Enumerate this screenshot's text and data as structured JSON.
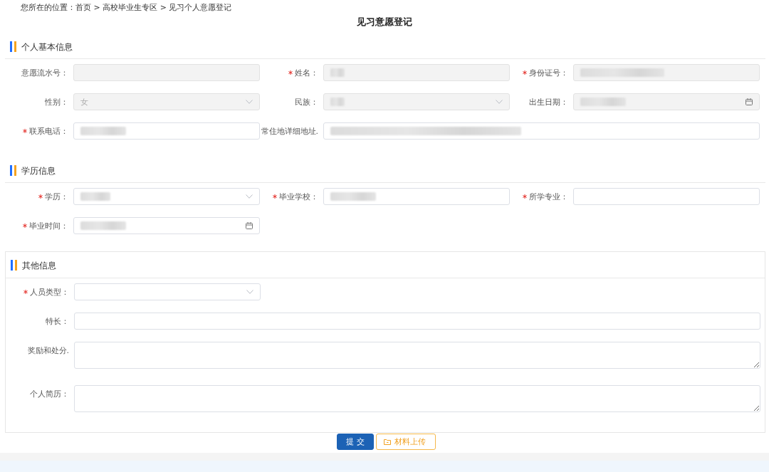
{
  "breadcrumb": "您所在的位置：首页 > 高校毕业生专区 > 见习个人意愿登记",
  "title": "见习意愿登记",
  "sections": [
    {
      "title": "个人基本信息",
      "boxed": false,
      "rows": [
        [
          {
            "label": "意愿流水号：",
            "kind": "text",
            "required": false,
            "disabled": true
          },
          {
            "label": "姓名：",
            "kind": "text",
            "required": true,
            "disabled": true,
            "blurred_value": {
              "kind": "short"
            }
          },
          {
            "label": "身份证号：",
            "kind": "text",
            "required": true,
            "disabled": true,
            "blurred_value": {
              "kind": "long"
            }
          }
        ],
        [
          {
            "label": "性别：",
            "kind": "select",
            "required": false,
            "disabled": true,
            "value": "女"
          },
          {
            "label": "民族：",
            "kind": "select",
            "required": false,
            "disabled": true,
            "blurred_value": {
              "kind": "short"
            }
          },
          {
            "label": "出生日期：",
            "kind": "date",
            "required": false,
            "disabled": true,
            "blurred_value": {
              "kind": "medium"
            }
          }
        ],
        [
          {
            "label": "联系电话：",
            "kind": "text",
            "required": true,
            "disabled": false,
            "blurred_value": {
              "kind": "medium"
            }
          },
          {
            "label": "常住地详细地址.",
            "kind": "wide_text",
            "required": false,
            "disabled": false,
            "blurred_value": {
              "kind": "full"
            }
          }
        ]
      ]
    },
    {
      "title": "学历信息",
      "boxed": false,
      "rows": [
        [
          {
            "label": "学历：",
            "kind": "select",
            "required": true,
            "disabled": false,
            "blurred_value": {
              "kind": "small"
            }
          },
          {
            "label": "毕业学校：",
            "kind": "text",
            "required": true,
            "disabled": false,
            "blurred_value": {
              "kind": "medium"
            }
          },
          {
            "label": "所学专业：",
            "kind": "text",
            "required": true,
            "disabled": false
          }
        ],
        [
          {
            "label": "毕业时间：",
            "kind": "date",
            "required": true,
            "disabled": false,
            "blurred_value": {
              "kind": "medium"
            }
          }
        ]
      ]
    },
    {
      "title": "其他信息",
      "boxed": true,
      "rows": [
        [
          {
            "label": "人员类型：",
            "kind": "select",
            "required": true,
            "disabled": false
          }
        ],
        [
          {
            "label": "特长：",
            "kind": "wide_text",
            "required": false,
            "disabled": false
          }
        ],
        [
          {
            "label": "奖励和处分.",
            "kind": "textarea",
            "required": false,
            "disabled": false
          }
        ],
        [
          {
            "label": "个人简历：",
            "kind": "textarea",
            "required": false,
            "disabled": false
          }
        ]
      ]
    }
  ],
  "buttons": [
    {
      "label": "提 交",
      "kind": "primary"
    },
    {
      "label": "材料上传",
      "kind": "upload"
    }
  ]
}
